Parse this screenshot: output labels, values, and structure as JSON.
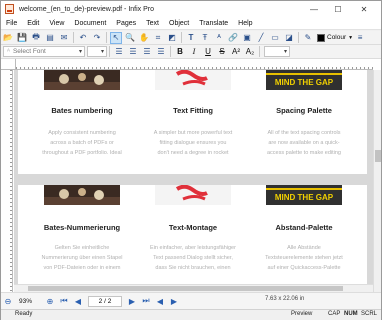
{
  "window": {
    "title": "welcome_(en_to_de)-preview.pdf - Infix Pro",
    "minimize": "—",
    "maximize": "☐",
    "close": "✕"
  },
  "menu": [
    "File",
    "Edit",
    "View",
    "Document",
    "Pages",
    "Text",
    "Object",
    "Translate",
    "Help"
  ],
  "toolbar1": {
    "colour_label": "Colour"
  },
  "toolbar2": {
    "font_placeholder": "Select Font"
  },
  "page1": {
    "columns": [
      {
        "heading": "Bates numbering",
        "body": [
          "Apply consistent numbering",
          "across a batch of PDFs or",
          "throughout a PDF portfolio. Ideal"
        ]
      },
      {
        "heading": "Text Fitting",
        "body": [
          "A simpler but more powerful text",
          "fitting dialogue ensures you",
          "don't need a degree in rocket"
        ]
      },
      {
        "heading": "Spacing Palette",
        "body": [
          "All of the text spacing controls",
          "are now available on a quick-",
          "access palette to make editing"
        ]
      }
    ],
    "thumb_text": "MIND THE GAP"
  },
  "page2": {
    "columns": [
      {
        "heading": "Bates-Nummerierung",
        "body": [
          "Gelten Sie einheitliche",
          "Nummerierung über einen Stapel",
          "von PDF-Dateien oder in einem"
        ]
      },
      {
        "heading": "Text-Montage",
        "body": [
          "Ein einfacher, aber leistungsfähiger",
          "Text passend Dialog stellt sicher,",
          "dass Sie nicht brauchen, einen"
        ]
      },
      {
        "heading": "Abstand-Palette",
        "body": [
          "Alle Abstände",
          "Textsteuerelemente stehen jetzt",
          "auf einer Quickaccess-Palette"
        ]
      }
    ],
    "thumb_text": "MIND THE GAP"
  },
  "navbar": {
    "zoom": "93%",
    "page_indicator": "2 / 2",
    "dimensions": "7.63 x 22.06 in"
  },
  "status": {
    "state": "Ready",
    "mode": "Preview",
    "cap": "CAP",
    "num": "NUM",
    "scrl": "SCRL"
  }
}
